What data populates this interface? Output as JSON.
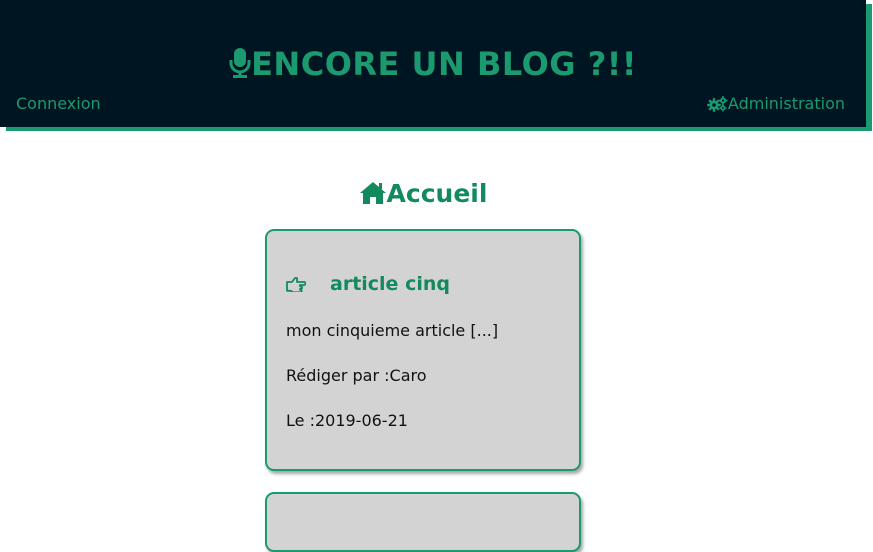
{
  "header": {
    "title": "ENCORE UN BLOG ?!!",
    "login_label": "Connexion",
    "admin_label": "Administration",
    "title_icon": "microphone-icon",
    "admin_icon": "gears-icon"
  },
  "page": {
    "heading": "Accueil",
    "heading_icon": "home-icon"
  },
  "articles": [
    {
      "title": "article cinq",
      "title_icon": "hand-point-right-icon",
      "excerpt": "mon cinquieme article [...]",
      "author_line": "Rédiger par :Caro",
      "date_line": "Le :2019-06-21"
    }
  ],
  "colors": {
    "header_bg": "#001522",
    "accent": "#1a9a6e",
    "card_bg": "#d3d3d3"
  }
}
